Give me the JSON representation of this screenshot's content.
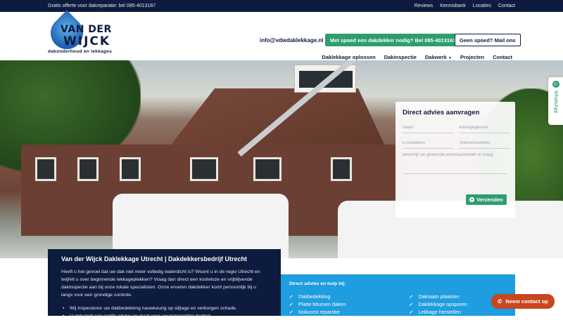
{
  "topbar": {
    "promo": "Gratis offerte voor dakreparatie: bel 085-4013167",
    "links": [
      "Reviews",
      "Kennisbank",
      "Locaties",
      "Contact"
    ]
  },
  "logo": {
    "line1": "VAN DER",
    "line2": "WIJCK",
    "tagline": "dakonderhoud en lekkages"
  },
  "header": {
    "email": "info@vdwdaklekkage.nl",
    "urgent_button": "Met spoed een dakdekker nodig? Bel 085-4013167",
    "mail_button": "Geen spoed? Mail ons"
  },
  "nav": {
    "items": [
      "Daklekkage oplossen",
      "Dakinspectie",
      "Dakwerk",
      "Projecten",
      "Contact"
    ]
  },
  "form": {
    "title": "Direct advies aanvragen",
    "name_placeholder": "Naam",
    "address_placeholder": "Adresgegevens",
    "email_placeholder": "E-mailadres",
    "phone_placeholder": "Telefoonnummer",
    "message_placeholder": "Beschrijf uw gewenste werkzaamheden of vraag",
    "submit": "Verzenden"
  },
  "whatsapp": {
    "label": "WhatsApp"
  },
  "info": {
    "title": "Van der Wijck Daklekkage Utrecht | Dakdekkersbedrijf Utrecht",
    "body": "Heeft u het gevoel dat uw dak niet meer volledig waterdicht is? Woont u in de regio Utrecht en twijfelt u over beginnende lekkageplekken? Vraag dan direct een kosteloze en vrijblijvende dakinspectie aan bij onze lokale specialisten. Onze ervaren dakdekker komt persoonlijk bij u langs voor een grondige controle.",
    "bullets": [
      "Wij inspecteren uw dakbedekking nauwkeurig op slijtage en verborgen schade.",
      "U ontvangt een eerlijk advies op maat voor uw persoonlijke budget."
    ]
  },
  "help": {
    "title": "Direct advies en hulp bij:",
    "col1": [
      "Dakbedekking",
      "Platte bitumen daken",
      "Nokvorst reparatie"
    ],
    "col2": [
      "Dakraam plaatsen",
      "Daklekkage opsporen",
      "Lekkage herstellen"
    ]
  },
  "call_button": "Neem contact op",
  "colors": {
    "navy": "#0d1b3e",
    "green": "#2e9e6f",
    "blue": "#1e9de0",
    "orange": "#c8471f"
  }
}
